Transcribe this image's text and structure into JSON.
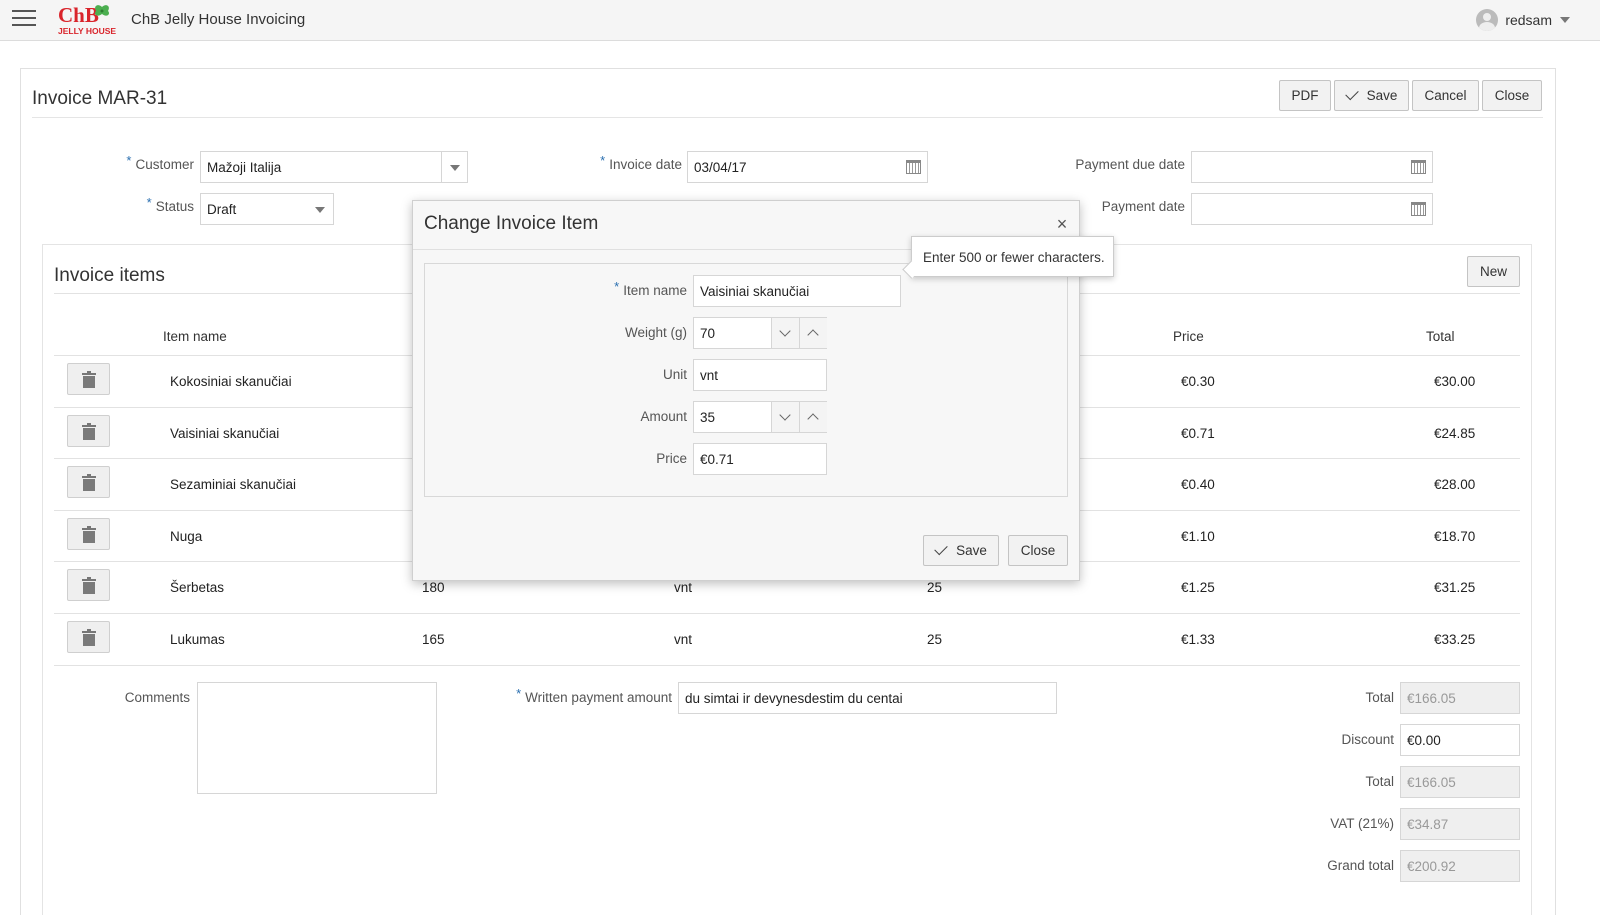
{
  "header": {
    "app_title": "ChB Jelly House Invoicing",
    "logo_text_top": "ChB",
    "logo_text_bottom": "JELLY HOUSE",
    "user_name": "redsam"
  },
  "page": {
    "title": "Invoice MAR-31",
    "buttons": {
      "pdf": "PDF",
      "save": "Save",
      "cancel": "Cancel",
      "close": "Close"
    }
  },
  "form": {
    "customer_label": "Customer",
    "customer_value": "Mažoji Italija",
    "status_label": "Status",
    "status_value": "Draft",
    "invoice_date_label": "Invoice date",
    "invoice_date_value": "03/04/17",
    "payment_due_date_label": "Payment due date",
    "payment_due_date_value": "",
    "payment_date_label": "Payment date",
    "payment_date_value": ""
  },
  "items": {
    "title": "Invoice items",
    "new_button": "New",
    "columns": {
      "item_name": "Item name",
      "price": "Price",
      "total": "Total"
    },
    "rows": [
      {
        "name": "Kokosiniai skanučiai",
        "weight": "",
        "unit": "",
        "amount": "",
        "price": "€0.30",
        "total": "€30.00"
      },
      {
        "name": "Vaisiniai skanučiai",
        "weight": "",
        "unit": "",
        "amount": "",
        "price": "€0.71",
        "total": "€24.85"
      },
      {
        "name": "Sezaminiai skanučiai",
        "weight": "",
        "unit": "",
        "amount": "",
        "price": "€0.40",
        "total": "€28.00"
      },
      {
        "name": "Nuga",
        "weight": "",
        "unit": "",
        "amount": "",
        "price": "€1.10",
        "total": "€18.70"
      },
      {
        "name": "Šerbetas",
        "weight": "180",
        "unit": "vnt",
        "amount": "25",
        "price": "€1.25",
        "total": "€31.25"
      },
      {
        "name": "Lukumas",
        "weight": "165",
        "unit": "vnt",
        "amount": "25",
        "price": "€1.33",
        "total": "€33.25"
      }
    ]
  },
  "footer": {
    "comments_label": "Comments",
    "written_amount_label": "Written payment amount",
    "written_amount_value": "du simtai ir devynesdestim du centai",
    "total_label": "Total",
    "total_value": "€166.05",
    "discount_label": "Discount",
    "discount_value": "€0.00",
    "total2_label": "Total",
    "total2_value": "€166.05",
    "vat_label": "VAT (21%)",
    "vat_value": "€34.87",
    "grand_total_label": "Grand total",
    "grand_total_value": "€200.92"
  },
  "dialog": {
    "title": "Change Invoice Item",
    "item_name_label": "Item name",
    "item_name_value": "Vaisiniai skanučiai",
    "weight_label": "Weight (g)",
    "weight_value": "70",
    "unit_label": "Unit",
    "unit_value": "vnt",
    "amount_label": "Amount",
    "amount_value": "35",
    "price_label": "Price",
    "price_value": "€0.71",
    "save_button": "Save",
    "close_button": "Close",
    "tooltip": "Enter 500 or fewer characters."
  },
  "colors": {
    "required_marker": "#2a6fb0",
    "logo_red": "#d9242b",
    "logo_green": "#4caf50"
  }
}
